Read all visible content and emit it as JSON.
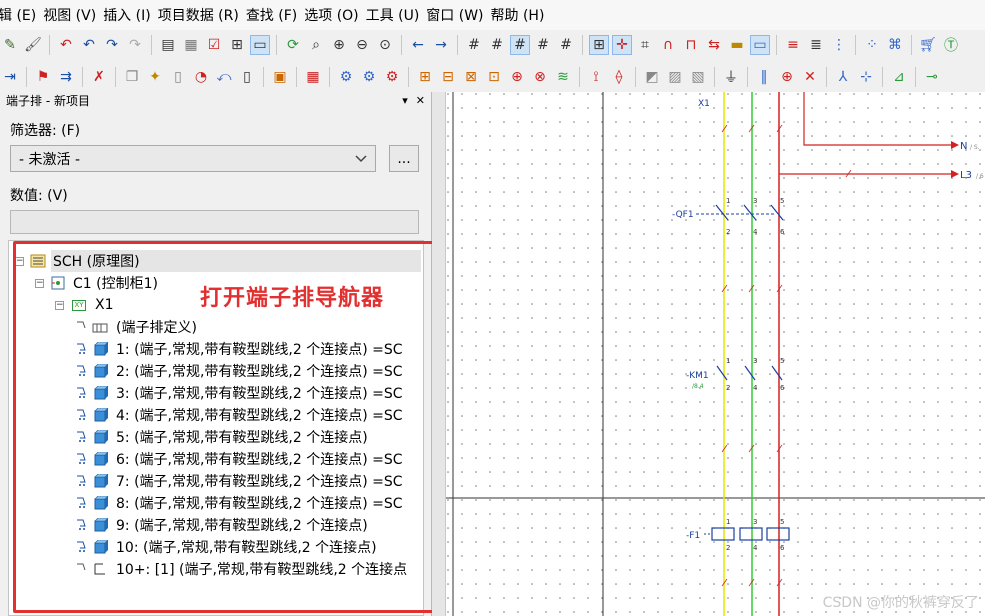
{
  "menu": [
    "辑 (E)",
    "视图 (V)",
    "插入 (I)",
    "项目数据 (R)",
    "查找 (F)",
    "选项 (O)",
    "工具 (U)",
    "窗口 (W)",
    "帮助 (H)"
  ],
  "panel": {
    "title": "端子排 - 新项目",
    "pin": "▾",
    "close": "✕",
    "filter_label": "筛选器: (F)",
    "filter_value": "- 未激活 -",
    "filter_more": "...",
    "value_label": "数值: (V)",
    "value_text": ""
  },
  "tree": {
    "root": "SCH (原理图)",
    "cabinet": "C1 (控制柜1)",
    "strip": "X1",
    "strip_badge": "XY",
    "items": [
      "(端子排定义)",
      "1: (端子,常规,带有鞍型跳线,2 个连接点) =SC",
      "2: (端子,常规,带有鞍型跳线,2 个连接点) =SC",
      "3: (端子,常规,带有鞍型跳线,2 个连接点) =SC",
      "4: (端子,常规,带有鞍型跳线,2 个连接点) =SC",
      "5: (端子,常规,带有鞍型跳线,2 个连接点)",
      "6: (端子,常规,带有鞍型跳线,2 个连接点) =SC",
      "7: (端子,常规,带有鞍型跳线,2 个连接点) =SC",
      "8: (端子,常规,带有鞍型跳线,2 个连接点) =SC",
      "9: (端子,常规,带有鞍型跳线,2 个连接点)",
      "10: (端子,常规,带有鞍型跳线,2 个连接点)",
      "10+: [1] (端子,常规,带有鞍型跳线,2 个连接点"
    ]
  },
  "annotation": "打开端子排导航器",
  "drawing": {
    "labels": {
      "x1": "X1",
      "n": "N",
      "n_suffix": "/ S.",
      "l3": "L3",
      "l3_suffix": "/ 6",
      "qf1": "-QF1",
      "km1": "-KM1",
      "km1_sub": "/8.4",
      "f1": "-F1",
      "p1": "1",
      "p2": "2",
      "p3": "3",
      "p4": "4",
      "p5": "5",
      "p6": "6"
    },
    "wire_colors": {
      "yellow": "#e6e600",
      "green": "#33cc33",
      "red": "#d42020"
    }
  },
  "watermark": "CSDN @你的秋裤穿反了"
}
